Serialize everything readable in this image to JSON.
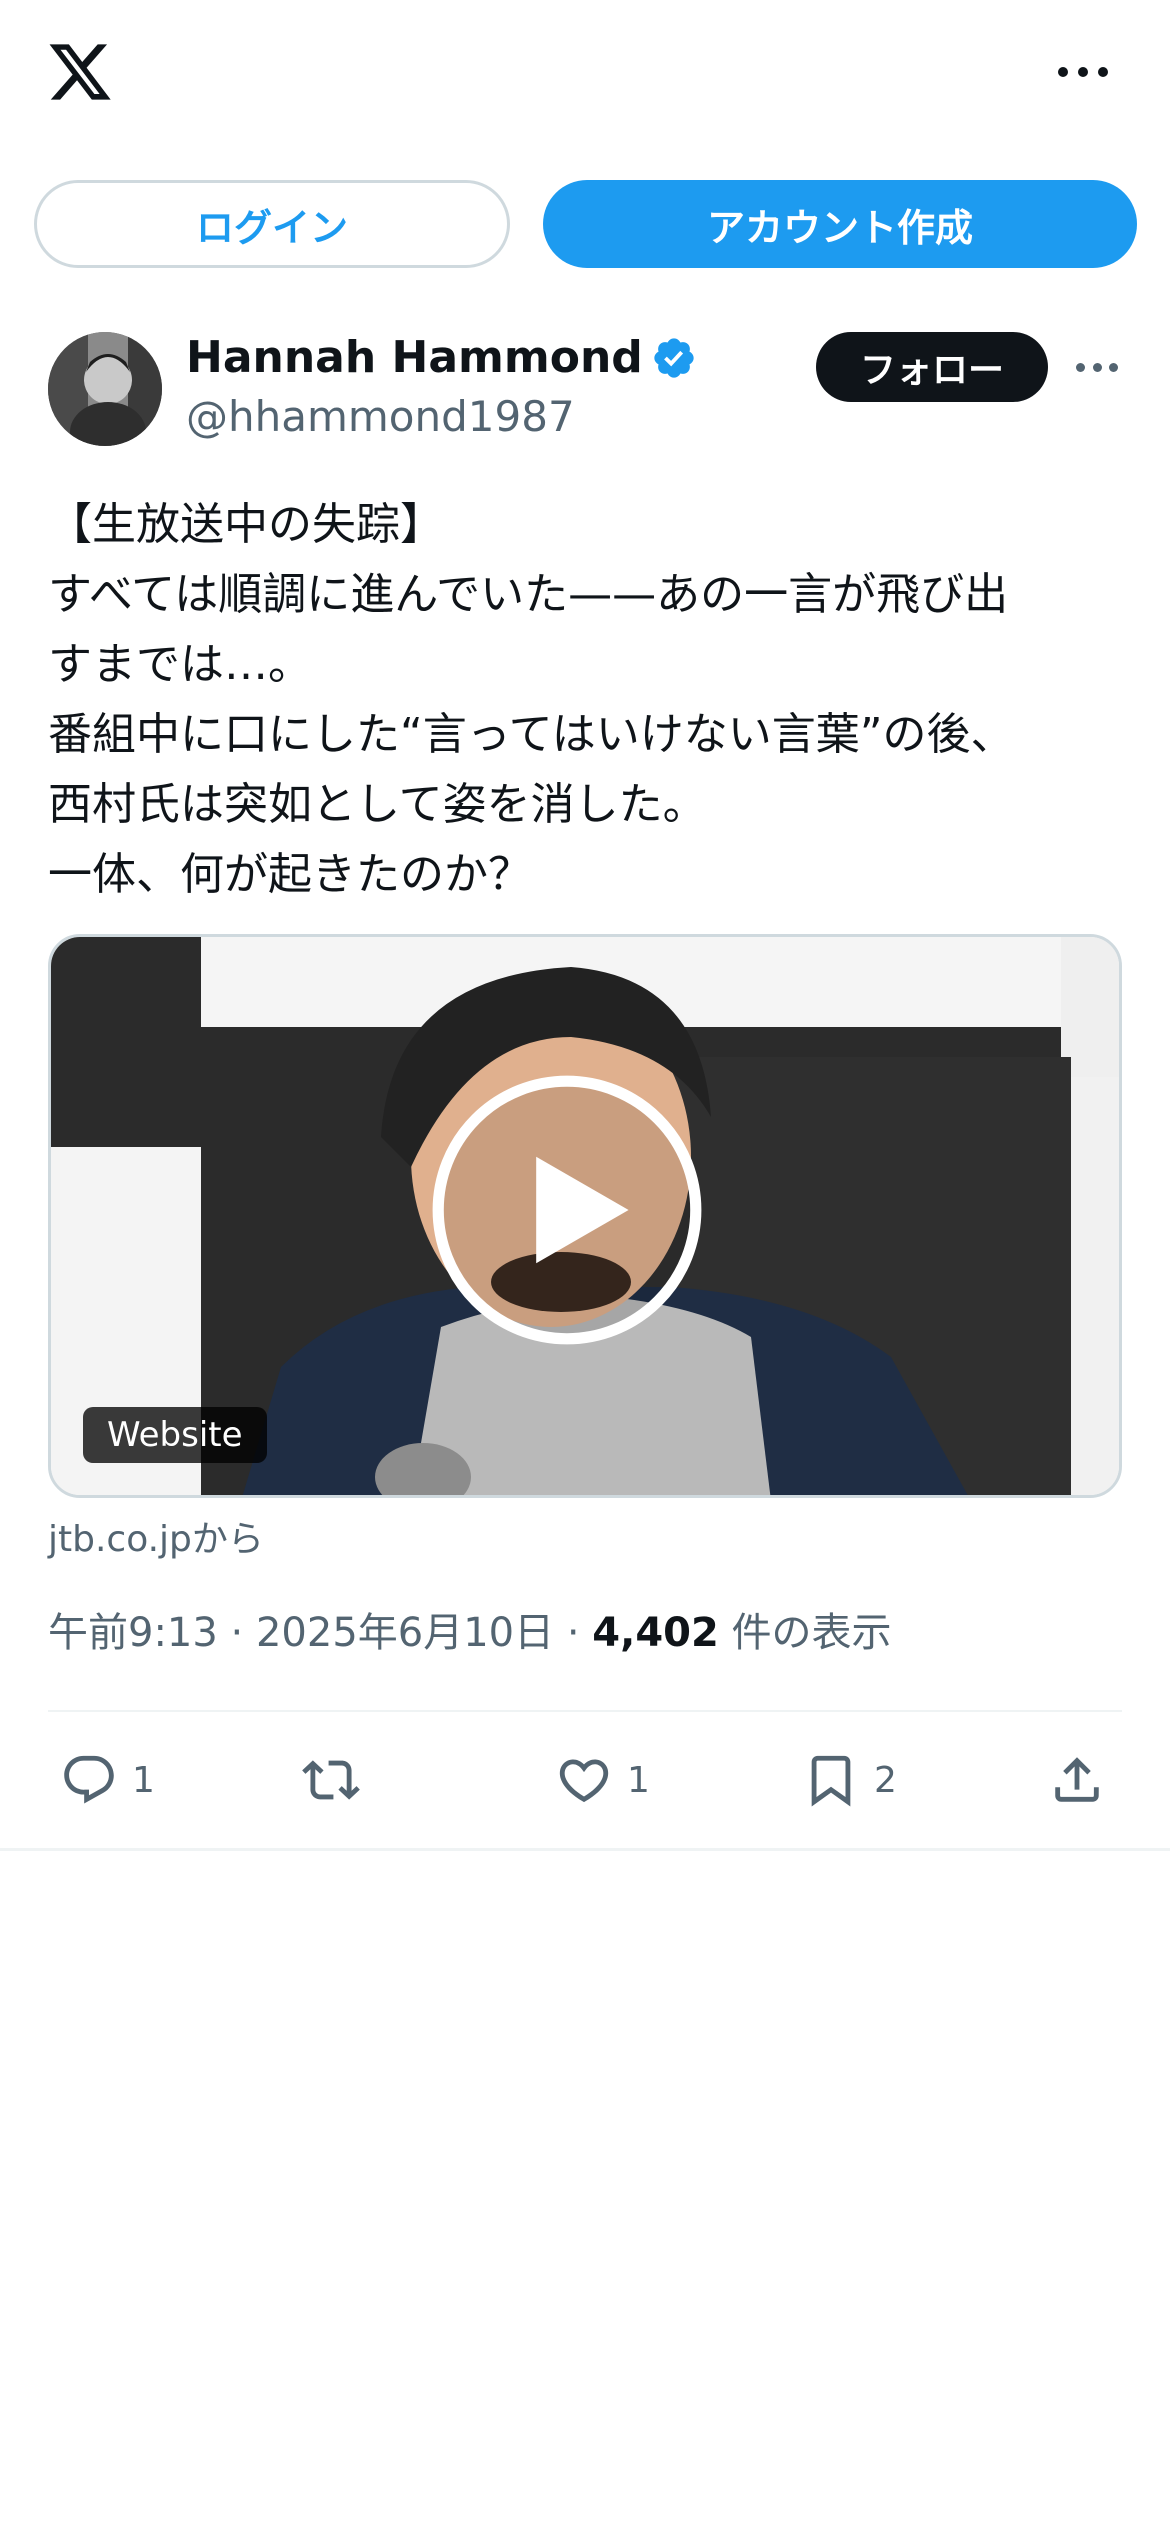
{
  "header": {
    "logo_icon": "x-logo-icon",
    "more_icon": "more-horizontal-icon"
  },
  "auth": {
    "login_label": "ログイン",
    "signup_label": "アカウント作成"
  },
  "post": {
    "author": {
      "name": "Hannah Hammond",
      "handle": "@hhammond1987",
      "verified": true
    },
    "follow_label": "フォロー",
    "text_lines": [
      "【生放送中の失踪】",
      "すべては順調に進んでいた——あの一言が飛び出",
      "すまでは…。",
      "番組中に口にした“言ってはいけない言葉”の後、",
      "西村氏は突如として姿を消した。",
      "一体、何が起きたのか？"
    ],
    "media": {
      "badge": "Website",
      "source": "jtb.co.jpから"
    },
    "meta": {
      "time": "午前9:13",
      "separator": "·",
      "date": "2025年6月10日",
      "views_count": "4,402",
      "views_label": "件の表示"
    },
    "actions": {
      "reply_count": "1",
      "repost_count": "",
      "like_count": "1",
      "bookmark_count": "2"
    }
  },
  "colors": {
    "accent": "#1d9bf0",
    "text": "#0f1419",
    "secondary": "#536471",
    "border": "#cfd9de"
  }
}
